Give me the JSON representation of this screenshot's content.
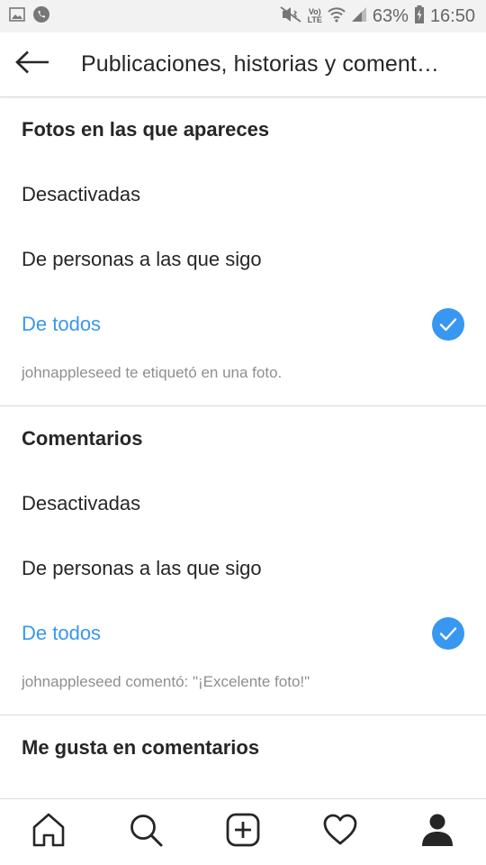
{
  "status_bar": {
    "signal_label_top": "Vo)",
    "signal_label_bottom": "LTE",
    "battery": "63%",
    "time": "16:50"
  },
  "header": {
    "title": "Publicaciones, historias y coment…"
  },
  "sections": [
    {
      "title": "Fotos en las que apareces",
      "options": [
        {
          "label": "Desactivadas"
        },
        {
          "label": "De personas a las que sigo"
        },
        {
          "label": "De todos"
        }
      ],
      "example": "johnappleseed te etiquetó en una foto."
    },
    {
      "title": "Comentarios",
      "options": [
        {
          "label": "Desactivadas"
        },
        {
          "label": "De personas a las que sigo"
        },
        {
          "label": "De todos"
        }
      ],
      "example": "johnappleseed comentó: \"¡Excelente foto!\""
    },
    {
      "title": "Me gusta en comentarios"
    }
  ],
  "colors": {
    "accent": "#3897f0",
    "text": "#262626",
    "muted": "#8e8e8e"
  },
  "bottom_nav": [
    "home-icon",
    "search-icon",
    "add-post-icon",
    "activity-heart-icon",
    "profile-icon"
  ]
}
